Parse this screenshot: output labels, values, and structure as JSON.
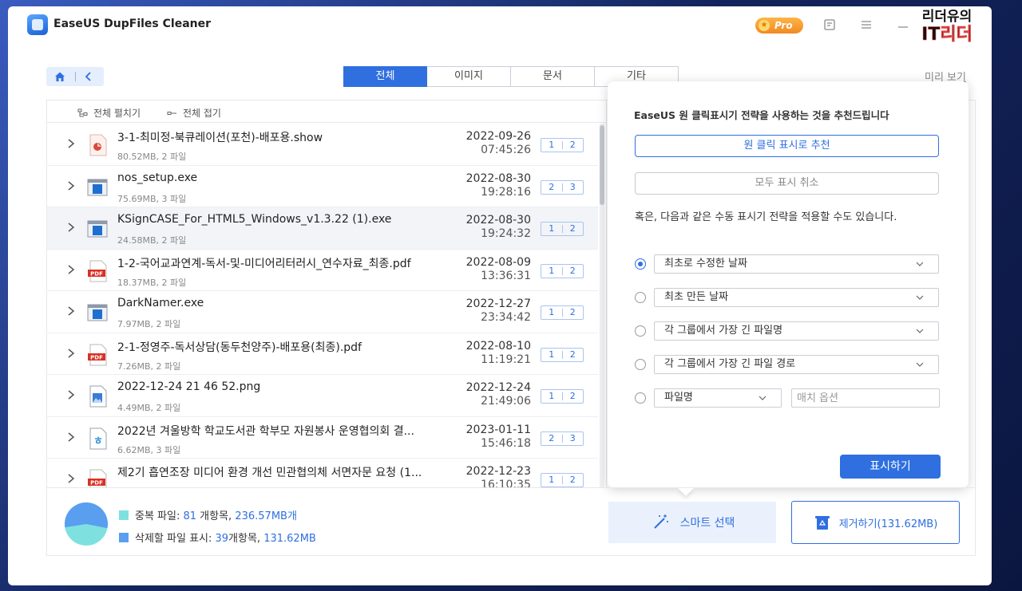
{
  "app": {
    "title": "EaseUS DupFiles Cleaner",
    "pro": "Pro"
  },
  "watermark": {
    "line1": "리더유의",
    "line2": "IT리더"
  },
  "tabs": [
    {
      "label": "전체"
    },
    {
      "label": "이미지"
    },
    {
      "label": "문서"
    },
    {
      "label": "기타"
    }
  ],
  "preview_link": "미리 보기",
  "list_toolbar": {
    "expand_all": "전체 펼치기",
    "collapse_all": "전체 접기"
  },
  "files": [
    {
      "name": "3-1-최미정-북큐레이션(포천)-배포용.show",
      "meta": "80.52MB, 2 파일",
      "date": "2022-09-26",
      "time": "07:45:26",
      "c1": "1",
      "c2": "2",
      "icon": "show-file-icon"
    },
    {
      "name": "nos_setup.exe",
      "meta": "75.69MB, 3 파일",
      "date": "2022-08-30",
      "time": "19:28:16",
      "c1": "2",
      "c2": "3",
      "icon": "exe-file-icon"
    },
    {
      "name": "KSignCASE_For_HTML5_Windows_v1.3.22 (1).exe",
      "meta": "24.58MB, 2 파일",
      "date": "2022-08-30",
      "time": "19:24:32",
      "c1": "1",
      "c2": "2",
      "icon": "exe-file-icon"
    },
    {
      "name": "1-2-국어교과연계-독서-및-미디어리터러시_연수자료_최종.pdf",
      "meta": "18.37MB, 2 파일",
      "date": "2022-08-09",
      "time": "13:36:31",
      "c1": "1",
      "c2": "2",
      "icon": "pdf-file-icon"
    },
    {
      "name": "DarkNamer.exe",
      "meta": "7.97MB, 2 파일",
      "date": "2022-12-27",
      "time": "23:34:42",
      "c1": "1",
      "c2": "2",
      "icon": "exe-file-icon"
    },
    {
      "name": "2-1-정영주-독서상담(동두천양주)-배포용(최종).pdf",
      "meta": "7.26MB, 2 파일",
      "date": "2022-08-10",
      "time": "11:19:21",
      "c1": "1",
      "c2": "2",
      "icon": "pdf-file-icon"
    },
    {
      "name": "2022-12-24 21 46 52.png",
      "meta": "4.49MB, 2 파일",
      "date": "2022-12-24",
      "time": "21:49:06",
      "c1": "1",
      "c2": "2",
      "icon": "image-file-icon"
    },
    {
      "name": "2022년 겨울방학 학교도서관 학부모 자원봉사 운영협의회 결...",
      "meta": "6.62MB, 3 파일",
      "date": "2023-01-11",
      "time": "15:46:18",
      "c1": "2",
      "c2": "3",
      "icon": "hwp-file-icon"
    },
    {
      "name": "제2기 흡연조장 미디어 환경 개선 민관협의체 서면자문 요청 (1...",
      "meta": "",
      "date": "2022-12-23",
      "time": "16:10:35",
      "c1": "1",
      "c2": "2",
      "icon": "pdf-file-icon"
    }
  ],
  "popup": {
    "title": "EaseUS 원 클릭표시기 전략을 사용하는 것을 추천드립니다",
    "recommend_btn": "원 클릭 표시로 추천",
    "clear_btn": "모두 표시 취소",
    "manual_text": "혹은, 다음과 같은 수동 표시기 전략을 적용할 수도 있습니다.",
    "options": [
      {
        "label": "최초로 수정한 날짜",
        "selected": true
      },
      {
        "label": "최초 만든 날짜",
        "selected": false
      },
      {
        "label": "각 그룹에서 가장 긴 파일명",
        "selected": false
      },
      {
        "label": "각 그룹에서 가장 긴 파일 경로",
        "selected": false
      }
    ],
    "filename_option": {
      "label": "파일명",
      "placeholder": "매치 옵션"
    },
    "apply_btn": "표시하기"
  },
  "footer": {
    "dup_label": "중복 파일: ",
    "dup_count": "81",
    "dup_mid": " 개항목, ",
    "dup_size": "236.57MB개",
    "del_label": "삭제할 파일 표시: ",
    "del_count": "39",
    "del_mid": "개항목, ",
    "del_size": "131.62MB",
    "smart_btn": "스마트 선택",
    "remove_btn": "제거하기(131.62MB)",
    "delete_fraction": 0.556
  },
  "colors": {
    "accent": "#2f6fe0",
    "dup_swatch": "#7fe0e0",
    "del_swatch": "#5a9ef0"
  }
}
